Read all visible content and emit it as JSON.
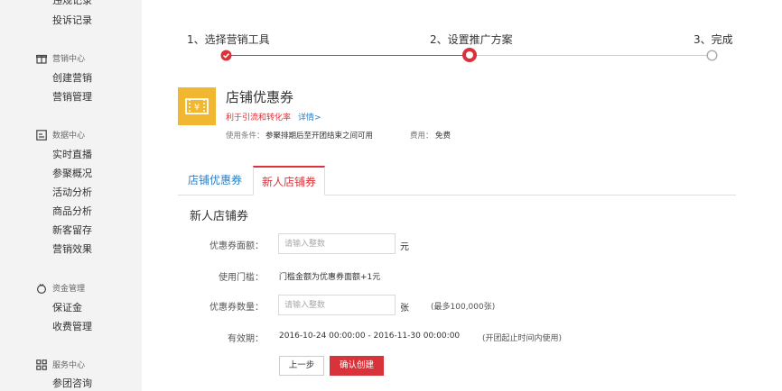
{
  "sidebar": {
    "top_items": [
      {
        "label": "违规记录"
      },
      {
        "label": "投诉记录"
      }
    ],
    "groups": [
      {
        "title": "营销中心",
        "icon": "gift-icon",
        "items": [
          {
            "label": "创建营销"
          },
          {
            "label": "营销管理"
          }
        ]
      },
      {
        "title": "数据中心",
        "icon": "chart-icon",
        "items": [
          {
            "label": "实时直播"
          },
          {
            "label": "参聚概况"
          },
          {
            "label": "活动分析"
          },
          {
            "label": "商品分析"
          },
          {
            "label": "新客留存"
          },
          {
            "label": "营销效果"
          }
        ]
      },
      {
        "title": "资金管理",
        "icon": "money-icon",
        "items": [
          {
            "label": "保证金"
          },
          {
            "label": "收费管理"
          }
        ]
      },
      {
        "title": "服务中心",
        "icon": "grid-icon",
        "items": [
          {
            "label": "参团咨询"
          }
        ]
      }
    ]
  },
  "steps": [
    {
      "label": "1、选择营销工具",
      "state": "done"
    },
    {
      "label": "2、设置推广方案",
      "state": "current"
    },
    {
      "label": "3、完成",
      "state": "pending"
    }
  ],
  "coupon": {
    "title": "店铺优惠券",
    "subtitle": "利于引流和转化率",
    "detail_link": "详情>",
    "condition_label": "使用条件：",
    "condition_value": "参聚排期后至开团结束之间可用",
    "fee_label": "费用：",
    "fee_value": "免费"
  },
  "tabs": [
    {
      "label": "店铺优惠券",
      "active": false
    },
    {
      "label": "新人店铺券",
      "active": true
    }
  ],
  "form": {
    "title": "新人店铺券",
    "amount_label": "优惠券面额：",
    "amount_placeholder": "请输入整数",
    "amount_unit": "元",
    "threshold_label": "使用门槛：",
    "threshold_value": "门槛金额为优惠券面额+1元",
    "quantity_label": "优惠券数量：",
    "quantity_placeholder": "请输入整数",
    "quantity_unit": "张",
    "quantity_hint": "(最多100,000张)",
    "validity_label": "有效期：",
    "validity_value": "2016-10-24 00:00:00 - 2016-11-30 00:00:00",
    "validity_hint": "(开团起止时间内使用)",
    "prev_button": "上一步",
    "confirm_button": "确认创建"
  },
  "colors": {
    "accent_red": "#d8333a",
    "link_blue": "#2c7ec3",
    "coupon_yellow": "#f2b731"
  }
}
